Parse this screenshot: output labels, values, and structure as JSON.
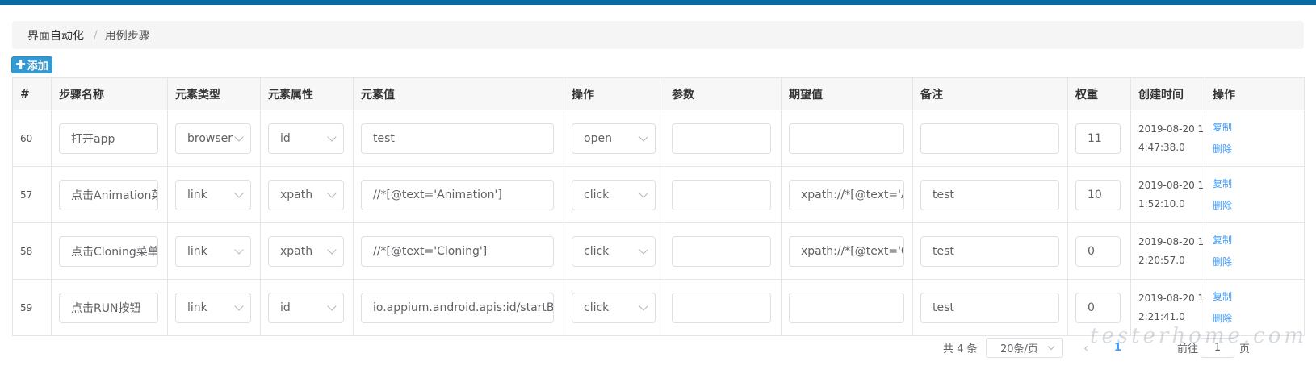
{
  "colors": {
    "topbar": "#0b6aa2",
    "add_button": "#3499d1",
    "link": "#409eff"
  },
  "breadcrumb": {
    "items": [
      "界面自动化",
      "用例步骤"
    ],
    "separator": "/"
  },
  "add_button": {
    "icon": "plus-icon",
    "label": "添加"
  },
  "table": {
    "headers": [
      "#",
      "步骤名称",
      "元素类型",
      "元素属性",
      "元素值",
      "操作",
      "参数",
      "期望值",
      "备注",
      "权重",
      "创建时间",
      "操作"
    ],
    "rows": [
      {
        "id": "60",
        "name": "打开app",
        "type": "browser",
        "attr": "id",
        "value": "test",
        "action": "open",
        "param": "",
        "expected": "",
        "remark": "",
        "weight": "11",
        "time_line1": "2019-08-20 1",
        "time_line2": "4:47:38.0",
        "copy": "复制",
        "delete": "删除"
      },
      {
        "id": "57",
        "name": "点击Animation菜",
        "type": "link",
        "attr": "xpath",
        "value": "//*[@text='Animation']",
        "action": "click",
        "param": "",
        "expected": "xpath://*[@text='Ar",
        "remark": "test",
        "weight": "10",
        "time_line1": "2019-08-20 1",
        "time_line2": "1:52:10.0",
        "copy": "复制",
        "delete": "删除"
      },
      {
        "id": "58",
        "name": "点击Cloning菜单",
        "type": "link",
        "attr": "xpath",
        "value": "//*[@text='Cloning']",
        "action": "click",
        "param": "",
        "expected": "xpath://*[@text='Cl",
        "remark": "test",
        "weight": "0",
        "time_line1": "2019-08-20 1",
        "time_line2": "2:20:57.0",
        "copy": "复制",
        "delete": "删除"
      },
      {
        "id": "59",
        "name": "点击RUN按钮",
        "type": "link",
        "attr": "id",
        "value": "io.appium.android.apis:id/startButto",
        "action": "click",
        "param": "",
        "expected": "",
        "remark": "test",
        "weight": "0",
        "time_line1": "2019-08-20 1",
        "time_line2": "2:21:41.0",
        "copy": "复制",
        "delete": "删除"
      }
    ]
  },
  "pagination": {
    "total": "共 4 条",
    "page_size": "20条/页",
    "prev_icon": "chevron-left-icon",
    "current_page": "1",
    "goto_label": "前往",
    "goto_value": "1",
    "page_suffix": "页"
  },
  "watermark": "testerhome.com"
}
